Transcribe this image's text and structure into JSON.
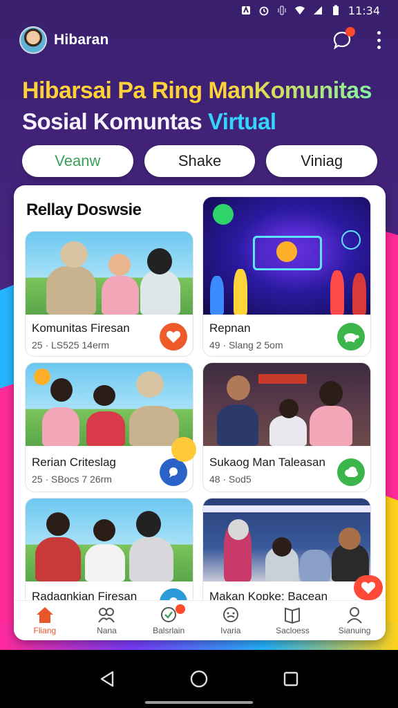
{
  "status_bar": {
    "time": "11:34"
  },
  "app_bar": {
    "title": "Hibaran"
  },
  "hero": {
    "line1": "Hibarsai Pa Ring ManKomunitas",
    "line2_a": "Sosial Komuntas ",
    "line2_b": "Virtual"
  },
  "tabs": [
    {
      "label": "Veanw",
      "active": true
    },
    {
      "label": "Shake",
      "active": false
    },
    {
      "label": "Viniag",
      "active": false
    }
  ],
  "section": {
    "title": "Rellay Doswsie"
  },
  "cards": [
    {
      "title": "Komunitas Firesan",
      "meta": "25 · LS525 14erm",
      "action_icon": "heart-icon",
      "action_color": "#ef5a2a"
    },
    {
      "title": "Repnan",
      "meta": "49 · Slang 2 5om",
      "action_icon": "turtle-icon",
      "action_color": "#3cb54a"
    },
    {
      "title": "Rerian Criteslag",
      "meta": "25 · SBocs 7 26rm",
      "action_icon": "chat-icon",
      "action_color": "#2a62c8"
    },
    {
      "title": "Sukaog Man Taleasan",
      "meta": "48 · Sod5",
      "action_icon": "cloud-icon",
      "action_color": "#3cb54a"
    },
    {
      "title": "Radagnkian Firesan",
      "meta": "",
      "action_icon": "chat-icon",
      "action_color": "#2a9ad8"
    },
    {
      "title": "Makan Kopke: Bacean",
      "meta": "",
      "action_icon": "heart-icon",
      "action_color": "#ff4a3a"
    }
  ],
  "bottom_nav": [
    {
      "label": "Fliang",
      "icon": "home-icon",
      "active": true
    },
    {
      "label": "Nana",
      "icon": "community-icon",
      "active": false
    },
    {
      "label": "Balsrlain",
      "icon": "badge-icon",
      "active": false,
      "badge": true
    },
    {
      "label": "Ivaria",
      "icon": "smile-icon",
      "active": false
    },
    {
      "label": "Sacloess",
      "icon": "book-icon",
      "active": false
    },
    {
      "label": "Sianuing",
      "icon": "profile-icon",
      "active": false
    }
  ],
  "colors": {
    "accent": "#e8562a",
    "primary_bg": "#3a1f6e",
    "highlight": "#37d3ff"
  }
}
